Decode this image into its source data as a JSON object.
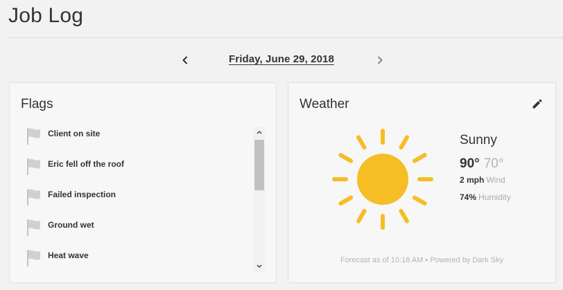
{
  "page": {
    "title": "Job Log"
  },
  "date_nav": {
    "date": "Friday, June 29, 2018"
  },
  "flags": {
    "title": "Flags",
    "items": [
      {
        "label": "Client on site"
      },
      {
        "label": "Eric fell off the roof"
      },
      {
        "label": "Failed inspection"
      },
      {
        "label": "Ground wet"
      },
      {
        "label": "Heat wave"
      }
    ]
  },
  "weather": {
    "title": "Weather",
    "condition": "Sunny",
    "high": "90°",
    "low": "70°",
    "wind_value": "2 mph",
    "wind_label": "Wind",
    "humidity_value": "74%",
    "humidity_label": "Humidity",
    "footer_forecast": "Forecast as of 10:18 AM",
    "footer_sep": " • ",
    "footer_powered": "Powered by Dark Sky",
    "sun_color": "#f6bd24"
  },
  "colors": {
    "background": "#f2f2f2",
    "card": "#f7f7f7",
    "text": "#333333",
    "muted": "#b3b3b3",
    "flag_gray": "#cccccc"
  },
  "icons": {
    "prev": "chevron-left-icon",
    "next": "chevron-right-icon",
    "flag": "flag-icon",
    "edit": "pencil-icon",
    "weather": "sun-icon"
  }
}
